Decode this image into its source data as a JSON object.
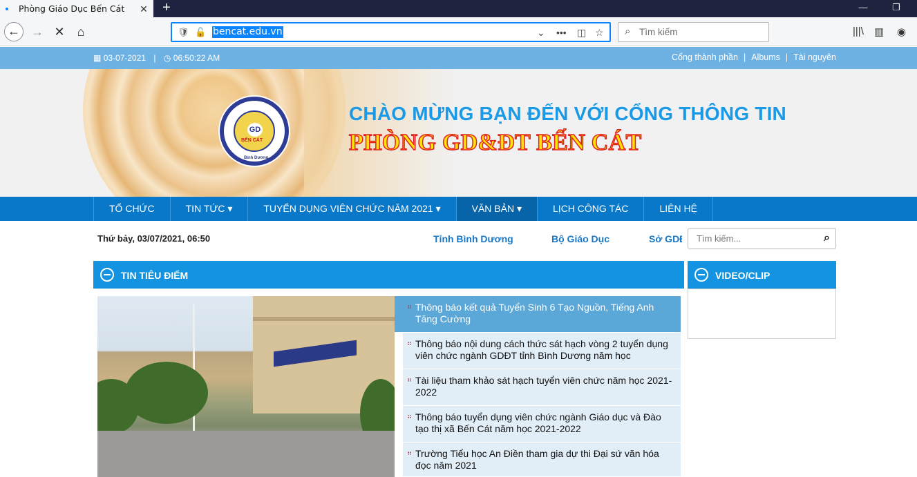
{
  "browser": {
    "tab_title": "Phòng Giáo Dục Bến Cát",
    "url": "bencat.edu.vn",
    "search_placeholder": "Tìm kiếm"
  },
  "topbar": {
    "date": "03-07-2021",
    "time": "06:50:22 AM",
    "links": [
      "Cổng thành phần",
      "Albums",
      "Tài nguyên"
    ]
  },
  "banner": {
    "welcome": "CHÀO MỪNG BẠN ĐẾN VỚI CỔNG THÔNG TIN",
    "dept": "PHÒNG GD&ĐT BẾN CÁT",
    "logo_gd": "GD",
    "logo_bc": "BẾN CÁT",
    "logo_bd": "Bình Dương"
  },
  "menu": [
    {
      "label": "TỔ CHỨC"
    },
    {
      "label": "TIN TỨC ▾"
    },
    {
      "label": "TUYỂN DỤNG VIÊN CHỨC NĂM 2021 ▾"
    },
    {
      "label": "VĂN BẢN ▾"
    },
    {
      "label": "LỊCH CÔNG TÁC"
    },
    {
      "label": "LIÊN HỆ"
    }
  ],
  "infobar": {
    "datetime": "Thứ bảy, 03/07/2021, 06:50",
    "links": [
      "Tỉnh Bình Dương",
      "Bộ Giáo Dục",
      "Sở GDĐ"
    ],
    "search_placeholder": "Tìm kiếm..."
  },
  "featured": {
    "title": "TIN TIÊU ĐIỂM",
    "items": [
      "Thông báo kết quả Tuyển Sinh 6 Tạo Nguồn, Tiếng Anh Tăng Cường",
      "Thông báo nội dung cách thức sát hạch vòng 2 tuyển dụng viên chức ngành GDĐT tỉnh Bình Dương năm học",
      "Tài liệu tham khảo sát hạch tuyển viên chức năm học 2021-2022",
      "Thông báo tuyển dụng viên chức ngành Giáo dục và Đào tạo thị xã Bến Cát năm học 2021-2022",
      "Trường Tiểu học An Điền tham gia dự thi Đại sứ văn hóa đọc năm 2021"
    ]
  },
  "video": {
    "title": "VIDEO/CLIP"
  }
}
